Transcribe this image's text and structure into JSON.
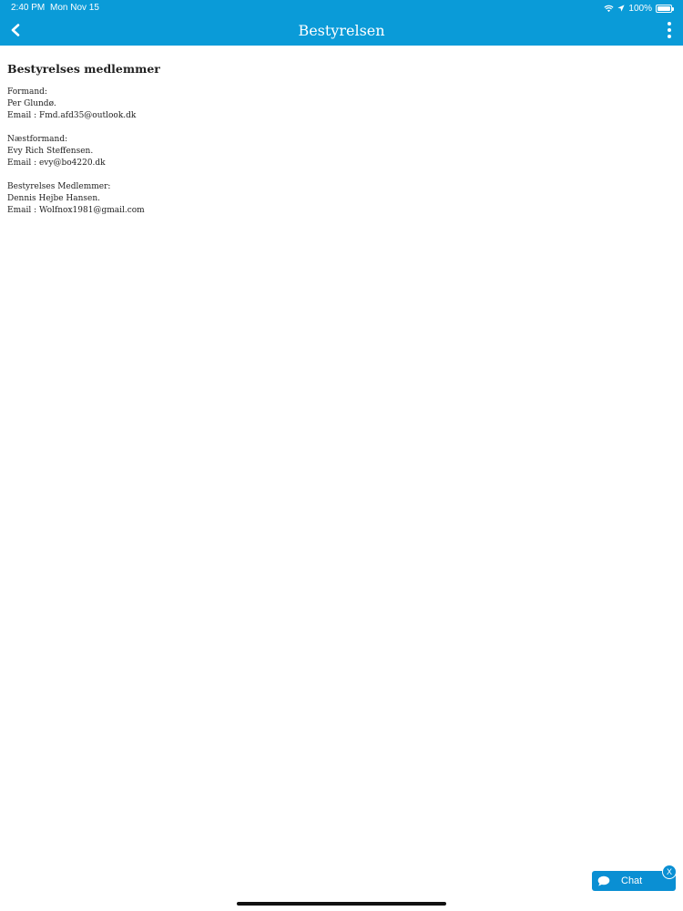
{
  "status_bar": {
    "time": "2:40 PM",
    "date": "Mon Nov 15",
    "battery": "100%"
  },
  "nav": {
    "title": "Bestyrelsen",
    "back_icon": "chevron-left-icon",
    "menu_icon": "more-vertical-icon"
  },
  "content": {
    "heading": "Bestyrelses medlemmer",
    "sections": [
      {
        "role": "Formand:",
        "name": "Per Glundø.",
        "email": "Email : Fmd.afd35@outlook.dk"
      },
      {
        "role": "Næstformand:",
        "name": "Evy Rich Steffensen.",
        "email": "Email : evy@bo4220.dk"
      },
      {
        "role": "Bestyrelses Medlemmer:",
        "name": "Dennis Hejbe Hansen.",
        "email": "Email : Wolfnox1981@gmail.com"
      }
    ]
  },
  "chat": {
    "label": "Chat",
    "close": "X"
  },
  "colors": {
    "primary": "#0a9bd8",
    "chat": "#0a8fd3"
  }
}
